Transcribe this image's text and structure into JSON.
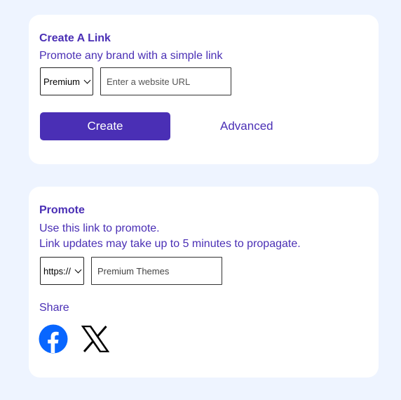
{
  "create_card": {
    "title": "Create A Link",
    "subtitle": "Promote any brand with a simple link",
    "tier_select": {
      "selected": "Premium"
    },
    "url_input": {
      "placeholder": "Enter a website URL",
      "value": ""
    },
    "create_button": "Create",
    "advanced_link": "Advanced"
  },
  "promote_card": {
    "title": "Promote",
    "line1": "Use this link to promote.",
    "line2": "Link updates may take up to 5 minutes to propagate.",
    "protocol_select": {
      "selected": "https://"
    },
    "link_input": {
      "value": "Premium Themes"
    },
    "share_label": "Share",
    "share_icons": [
      "facebook-icon",
      "x-icon"
    ]
  },
  "colors": {
    "background": "#eef4ff",
    "card": "#ffffff",
    "accent": "#4a2fb5",
    "facebook": "#0866ff"
  }
}
